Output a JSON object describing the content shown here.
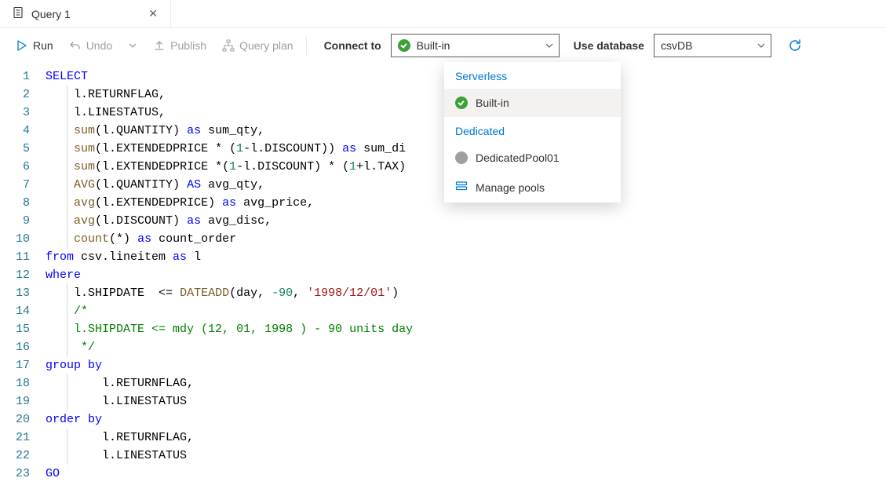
{
  "tab": {
    "title": "Query 1"
  },
  "toolbar": {
    "run": "Run",
    "undo": "Undo",
    "publish": "Publish",
    "plan": "Query plan",
    "connect_to": "Connect to",
    "use_database": "Use database"
  },
  "connect_dropdown": {
    "selected": "Built-in",
    "groups": [
      {
        "label": "Serverless",
        "items": [
          {
            "name": "Built-in",
            "status": "active",
            "selected": true
          }
        ]
      },
      {
        "label": "Dedicated",
        "items": [
          {
            "name": "DedicatedPool01",
            "status": "paused",
            "selected": false
          }
        ]
      }
    ],
    "manage": "Manage pools"
  },
  "database_dropdown": {
    "selected": "csvDB"
  },
  "code": {
    "lines": [
      [
        {
          "c": "kw",
          "t": "SELECT"
        }
      ],
      [
        {
          "c": "txt",
          "t": "    l.RETURNFLAG,"
        }
      ],
      [
        {
          "c": "txt",
          "t": "    l.LINESTATUS,"
        }
      ],
      [
        {
          "c": "txt",
          "t": "    "
        },
        {
          "c": "fn",
          "t": "sum"
        },
        {
          "c": "txt",
          "t": "(l.QUANTITY) "
        },
        {
          "c": "kw",
          "t": "as"
        },
        {
          "c": "txt",
          "t": " sum_qty,"
        }
      ],
      [
        {
          "c": "txt",
          "t": "    "
        },
        {
          "c": "fn",
          "t": "sum"
        },
        {
          "c": "txt",
          "t": "(l.EXTENDEDPRICE * ("
        },
        {
          "c": "num",
          "t": "1"
        },
        {
          "c": "txt",
          "t": "-l.DISCOUNT)) "
        },
        {
          "c": "kw",
          "t": "as"
        },
        {
          "c": "txt",
          "t": " sum_di"
        }
      ],
      [
        {
          "c": "txt",
          "t": "    "
        },
        {
          "c": "fn",
          "t": "sum"
        },
        {
          "c": "txt",
          "t": "(l.EXTENDEDPRICE *("
        },
        {
          "c": "num",
          "t": "1"
        },
        {
          "c": "txt",
          "t": "-l.DISCOUNT) * ("
        },
        {
          "c": "num",
          "t": "1"
        },
        {
          "c": "txt",
          "t": "+l.TAX)"
        }
      ],
      [
        {
          "c": "txt",
          "t": "    "
        },
        {
          "c": "fn",
          "t": "AVG"
        },
        {
          "c": "txt",
          "t": "(l.QUANTITY) "
        },
        {
          "c": "kw",
          "t": "AS"
        },
        {
          "c": "txt",
          "t": " avg_qty,"
        }
      ],
      [
        {
          "c": "txt",
          "t": "    "
        },
        {
          "c": "fn",
          "t": "avg"
        },
        {
          "c": "txt",
          "t": "(l.EXTENDEDPRICE) "
        },
        {
          "c": "kw",
          "t": "as"
        },
        {
          "c": "txt",
          "t": " avg_price,"
        }
      ],
      [
        {
          "c": "txt",
          "t": "    "
        },
        {
          "c": "fn",
          "t": "avg"
        },
        {
          "c": "txt",
          "t": "(l.DISCOUNT) "
        },
        {
          "c": "kw",
          "t": "as"
        },
        {
          "c": "txt",
          "t": " avg_disc,"
        }
      ],
      [
        {
          "c": "txt",
          "t": "    "
        },
        {
          "c": "fn",
          "t": "count"
        },
        {
          "c": "txt",
          "t": "(*) "
        },
        {
          "c": "kw",
          "t": "as"
        },
        {
          "c": "txt",
          "t": " count_order"
        }
      ],
      [
        {
          "c": "kw",
          "t": "from"
        },
        {
          "c": "txt",
          "t": " csv.lineitem "
        },
        {
          "c": "kw",
          "t": "as"
        },
        {
          "c": "txt",
          "t": " l"
        }
      ],
      [
        {
          "c": "kw",
          "t": "where"
        }
      ],
      [
        {
          "c": "txt",
          "t": "    l.SHIPDATE  <= "
        },
        {
          "c": "fn",
          "t": "DATEADD"
        },
        {
          "c": "txt",
          "t": "(day, "
        },
        {
          "c": "num",
          "t": "-90"
        },
        {
          "c": "txt",
          "t": ", "
        },
        {
          "c": "str",
          "t": "'1998/12/01'"
        },
        {
          "c": "txt",
          "t": ")"
        }
      ],
      [
        {
          "c": "cmt",
          "t": "    /*"
        }
      ],
      [
        {
          "c": "cmt",
          "t": "    l.SHIPDATE <= mdy (12, 01, 1998 ) - 90 units day"
        }
      ],
      [
        {
          "c": "cmt",
          "t": "     */"
        }
      ],
      [
        {
          "c": "kw",
          "t": "group by"
        }
      ],
      [
        {
          "c": "txt",
          "t": "        l.RETURNFLAG,"
        }
      ],
      [
        {
          "c": "txt",
          "t": "        l.LINESTATUS"
        }
      ],
      [
        {
          "c": "kw",
          "t": "order by"
        }
      ],
      [
        {
          "c": "txt",
          "t": "        l.RETURNFLAG,"
        }
      ],
      [
        {
          "c": "txt",
          "t": "        l.LINESTATUS"
        }
      ],
      [
        {
          "c": "kw",
          "t": "GO"
        }
      ]
    ]
  }
}
